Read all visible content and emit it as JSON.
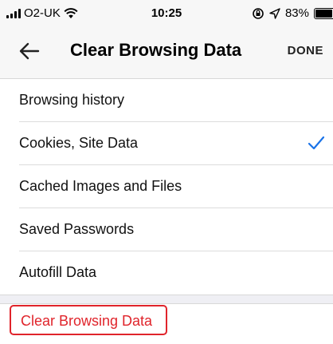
{
  "status_bar": {
    "carrier": "O2-UK",
    "time": "10:25",
    "battery": "83%",
    "battery_level": 0.83,
    "icons": [
      "signal-icon",
      "wifi-icon",
      "rotation-lock-icon",
      "location-icon",
      "battery-icon"
    ]
  },
  "nav": {
    "back_icon": "back-arrow-icon",
    "title": "Clear Browsing Data",
    "done_label": "DONE"
  },
  "items": [
    {
      "label": "Browsing history",
      "checked": false
    },
    {
      "label": "Cookies, Site Data",
      "checked": true
    },
    {
      "label": "Cached Images and Files",
      "checked": false
    },
    {
      "label": "Saved Passwords",
      "checked": false
    },
    {
      "label": "Autofill Data",
      "checked": false
    }
  ],
  "action": {
    "clear_label": "Clear Browsing Data"
  },
  "colors": {
    "accent_blue": "#1a73e8",
    "destructive_red": "#e0242b",
    "highlight_border": "#e0242b"
  }
}
